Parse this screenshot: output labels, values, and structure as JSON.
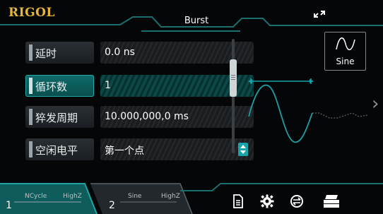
{
  "header": {
    "logo": "RIGOL",
    "title": "Burst",
    "link_icon": "link-icon"
  },
  "settings": [
    {
      "label": "延时",
      "value": "0.0 ns",
      "active": false
    },
    {
      "label": "循环数",
      "value": "1",
      "active": true
    },
    {
      "label": "猝发周期",
      "value": "10.000,000,0 ms",
      "active": false
    },
    {
      "label": "空闲电平",
      "value": "第一个点",
      "active": false,
      "dropdown": true
    }
  ],
  "preview": {
    "waveform_label": "Sine",
    "waveform_icon": "sine-wave-icon"
  },
  "channels": [
    {
      "number": "1",
      "mode": "NCycle",
      "impedance": "HighZ",
      "active": true
    },
    {
      "number": "2",
      "mode": "Sine",
      "impedance": "HighZ",
      "active": false
    }
  ],
  "toolbar": [
    "file-icon",
    "gear-icon",
    "sync-icon",
    "print-icon"
  ],
  "colors": {
    "accent": "#1aa3a8",
    "logo": "#e8b43a",
    "active_bg": "#0f6b6a"
  }
}
